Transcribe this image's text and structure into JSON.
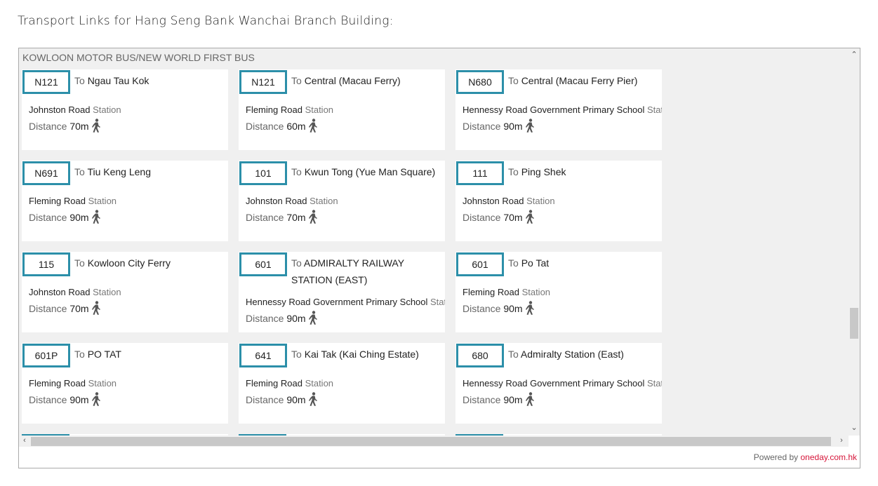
{
  "title": "Transport Links for Hang Seng Bank Wanchai Branch Building:",
  "section": "KOWLOON MOTOR BUS/NEW WORLD FIRST BUS",
  "labels": {
    "to": "To",
    "station": "Station",
    "distance": "Distance"
  },
  "accent": "#2c8fa9",
  "routes": [
    {
      "route": "N121",
      "dest": "Ngau Tau Kok",
      "station": "Johnston Road",
      "distance": "70m"
    },
    {
      "route": "N121",
      "dest": "Central (Macau Ferry)",
      "station": "Fleming Road",
      "distance": "60m"
    },
    {
      "route": "N680",
      "dest": "Central (Macau Ferry Pier)",
      "station": "Hennessy Road Government Primary School",
      "distance": "90m"
    },
    {
      "route": "N691",
      "dest": "Tiu Keng Leng",
      "station": "Fleming Road",
      "distance": "90m"
    },
    {
      "route": "101",
      "dest": "Kwun Tong (Yue Man Square)",
      "station": "Johnston Road",
      "distance": "70m"
    },
    {
      "route": "111",
      "dest": "Ping Shek",
      "station": "Johnston Road",
      "distance": "70m"
    },
    {
      "route": "115",
      "dest": "Kowloon City Ferry",
      "station": "Johnston Road",
      "distance": "70m"
    },
    {
      "route": "601",
      "dest": "ADMIRALTY RAILWAY STATION (EAST)",
      "station": "Hennessy Road Government Primary School",
      "distance": "90m"
    },
    {
      "route": "601",
      "dest": "Po Tat",
      "station": "Fleming Road",
      "distance": "90m"
    },
    {
      "route": "601P",
      "dest": "PO TAT",
      "station": "Fleming Road",
      "distance": "90m"
    },
    {
      "route": "641",
      "dest": "Kai Tak (Kai Ching Estate)",
      "station": "Fleming Road",
      "distance": "90m"
    },
    {
      "route": "680",
      "dest": "Admiralty Station (East)",
      "station": "Hennessy Road Government Primary School",
      "distance": "90m"
    }
  ],
  "footer": {
    "prefix": "Powered by",
    "link": "oneday.com.hk"
  }
}
